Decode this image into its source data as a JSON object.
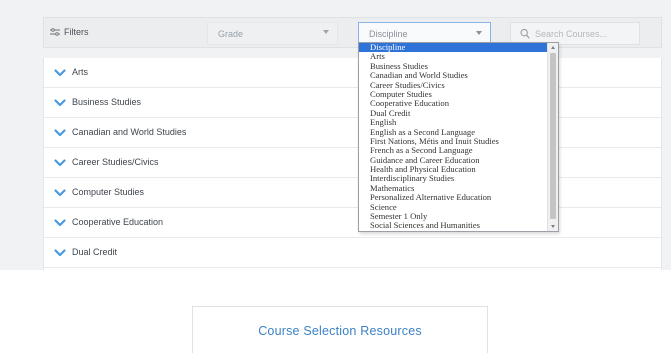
{
  "colors": {
    "accent": "#2f73d9",
    "chevron": "#4a98df",
    "link": "#3c82c6"
  },
  "filters": {
    "label": "Filters",
    "icon": "sliders-icon",
    "grade": {
      "value": "Grade"
    },
    "discipline": {
      "value": "Discipline"
    },
    "search": {
      "placeholder": "Search Courses...",
      "icon": "search-icon"
    }
  },
  "accordion": {
    "items": [
      {
        "label": "Arts"
      },
      {
        "label": "Business Studies"
      },
      {
        "label": "Canadian and World Studies"
      },
      {
        "label": "Career Studies/Civics"
      },
      {
        "label": "Computer Studies"
      },
      {
        "label": "Cooperative Education"
      },
      {
        "label": "Dual Credit"
      }
    ]
  },
  "dropdown": {
    "selected": "Discipline",
    "options": [
      "Discipline",
      "Arts",
      "Business Studies",
      "Canadian and World Studies",
      "Career Studies/Civics",
      "Computer Studies",
      "Cooperative Education",
      "Dual Credit",
      "English",
      "English as a Second Language",
      "First Nations, Métis and Inuit Studies",
      "French as a Second Language",
      "Guidance and Career Education",
      "Health and Physical Education",
      "Interdisciplinary Studies",
      "Mathematics",
      "Personalized Alternative Education",
      "Science",
      "Semester 1 Only",
      "Social Sciences and Humanities"
    ]
  },
  "resources": {
    "label": "Course Selection Resources"
  }
}
